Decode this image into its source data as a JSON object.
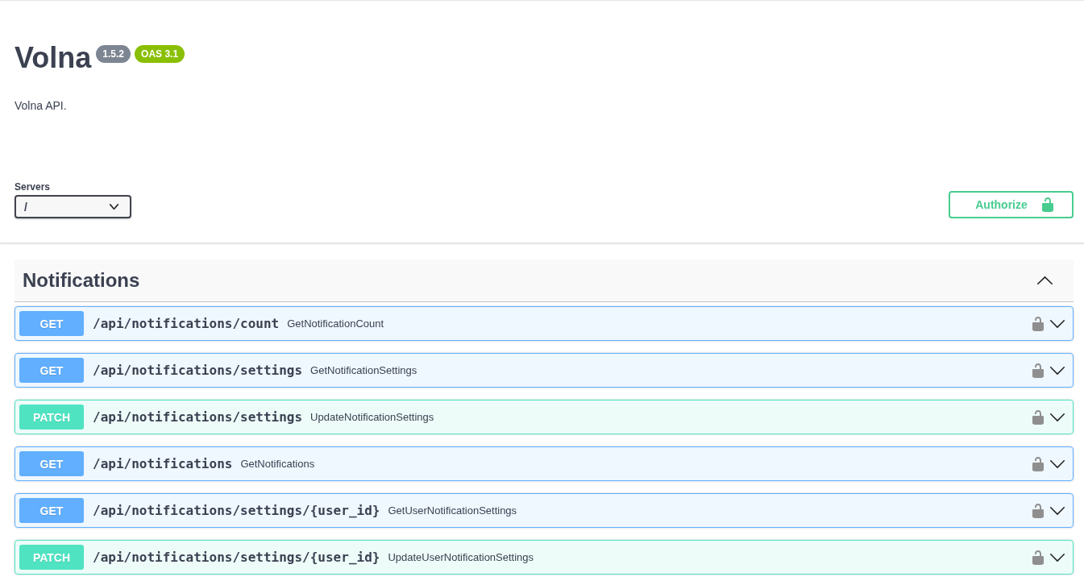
{
  "info": {
    "title": "Volna",
    "version": "1.5.2",
    "oas_version": "OAS 3.1",
    "description": "Volna API."
  },
  "servers": {
    "label": "Servers",
    "value": "/"
  },
  "authorize": {
    "label": "Authorize",
    "locked": false
  },
  "tag": {
    "name": "Notifications",
    "expanded": true
  },
  "operations": [
    {
      "method": "GET",
      "path": "/api/notifications/count",
      "summary": "GetNotificationCount",
      "color": "#61affe",
      "locked": false,
      "expanded": false
    },
    {
      "method": "GET",
      "path": "/api/notifications/settings",
      "summary": "GetNotificationSettings",
      "color": "#61affe",
      "locked": false,
      "expanded": false
    },
    {
      "method": "PATCH",
      "path": "/api/notifications/settings",
      "summary": "UpdateNotificationSettings",
      "color": "#50e3c2",
      "locked": false,
      "expanded": false
    },
    {
      "method": "GET",
      "path": "/api/notifications",
      "summary": "GetNotifications",
      "color": "#61affe",
      "locked": false,
      "expanded": false
    },
    {
      "method": "GET",
      "path": "/api/notifications/settings/{user_id}",
      "summary": "GetUserNotificationSettings",
      "color": "#61affe",
      "locked": false,
      "expanded": false
    },
    {
      "method": "PATCH",
      "path": "/api/notifications/settings/{user_id}",
      "summary": "UpdateUserNotificationSettings",
      "color": "#50e3c2",
      "locked": false,
      "expanded": false
    }
  ]
}
